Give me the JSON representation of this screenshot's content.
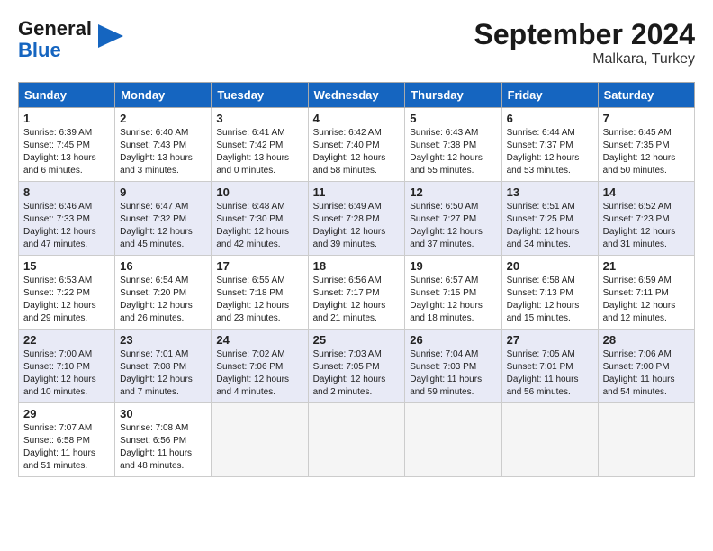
{
  "header": {
    "logo_general": "General",
    "logo_blue": "Blue",
    "month_title": "September 2024",
    "location": "Malkara, Turkey"
  },
  "weekdays": [
    "Sunday",
    "Monday",
    "Tuesday",
    "Wednesday",
    "Thursday",
    "Friday",
    "Saturday"
  ],
  "weeks": [
    [
      {
        "day": "1",
        "sunrise": "Sunrise: 6:39 AM",
        "sunset": "Sunset: 7:45 PM",
        "daylight": "Daylight: 13 hours and 6 minutes."
      },
      {
        "day": "2",
        "sunrise": "Sunrise: 6:40 AM",
        "sunset": "Sunset: 7:43 PM",
        "daylight": "Daylight: 13 hours and 3 minutes."
      },
      {
        "day": "3",
        "sunrise": "Sunrise: 6:41 AM",
        "sunset": "Sunset: 7:42 PM",
        "daylight": "Daylight: 13 hours and 0 minutes."
      },
      {
        "day": "4",
        "sunrise": "Sunrise: 6:42 AM",
        "sunset": "Sunset: 7:40 PM",
        "daylight": "Daylight: 12 hours and 58 minutes."
      },
      {
        "day": "5",
        "sunrise": "Sunrise: 6:43 AM",
        "sunset": "Sunset: 7:38 PM",
        "daylight": "Daylight: 12 hours and 55 minutes."
      },
      {
        "day": "6",
        "sunrise": "Sunrise: 6:44 AM",
        "sunset": "Sunset: 7:37 PM",
        "daylight": "Daylight: 12 hours and 53 minutes."
      },
      {
        "day": "7",
        "sunrise": "Sunrise: 6:45 AM",
        "sunset": "Sunset: 7:35 PM",
        "daylight": "Daylight: 12 hours and 50 minutes."
      }
    ],
    [
      {
        "day": "8",
        "sunrise": "Sunrise: 6:46 AM",
        "sunset": "Sunset: 7:33 PM",
        "daylight": "Daylight: 12 hours and 47 minutes."
      },
      {
        "day": "9",
        "sunrise": "Sunrise: 6:47 AM",
        "sunset": "Sunset: 7:32 PM",
        "daylight": "Daylight: 12 hours and 45 minutes."
      },
      {
        "day": "10",
        "sunrise": "Sunrise: 6:48 AM",
        "sunset": "Sunset: 7:30 PM",
        "daylight": "Daylight: 12 hours and 42 minutes."
      },
      {
        "day": "11",
        "sunrise": "Sunrise: 6:49 AM",
        "sunset": "Sunset: 7:28 PM",
        "daylight": "Daylight: 12 hours and 39 minutes."
      },
      {
        "day": "12",
        "sunrise": "Sunrise: 6:50 AM",
        "sunset": "Sunset: 7:27 PM",
        "daylight": "Daylight: 12 hours and 37 minutes."
      },
      {
        "day": "13",
        "sunrise": "Sunrise: 6:51 AM",
        "sunset": "Sunset: 7:25 PM",
        "daylight": "Daylight: 12 hours and 34 minutes."
      },
      {
        "day": "14",
        "sunrise": "Sunrise: 6:52 AM",
        "sunset": "Sunset: 7:23 PM",
        "daylight": "Daylight: 12 hours and 31 minutes."
      }
    ],
    [
      {
        "day": "15",
        "sunrise": "Sunrise: 6:53 AM",
        "sunset": "Sunset: 7:22 PM",
        "daylight": "Daylight: 12 hours and 29 minutes."
      },
      {
        "day": "16",
        "sunrise": "Sunrise: 6:54 AM",
        "sunset": "Sunset: 7:20 PM",
        "daylight": "Daylight: 12 hours and 26 minutes."
      },
      {
        "day": "17",
        "sunrise": "Sunrise: 6:55 AM",
        "sunset": "Sunset: 7:18 PM",
        "daylight": "Daylight: 12 hours and 23 minutes."
      },
      {
        "day": "18",
        "sunrise": "Sunrise: 6:56 AM",
        "sunset": "Sunset: 7:17 PM",
        "daylight": "Daylight: 12 hours and 21 minutes."
      },
      {
        "day": "19",
        "sunrise": "Sunrise: 6:57 AM",
        "sunset": "Sunset: 7:15 PM",
        "daylight": "Daylight: 12 hours and 18 minutes."
      },
      {
        "day": "20",
        "sunrise": "Sunrise: 6:58 AM",
        "sunset": "Sunset: 7:13 PM",
        "daylight": "Daylight: 12 hours and 15 minutes."
      },
      {
        "day": "21",
        "sunrise": "Sunrise: 6:59 AM",
        "sunset": "Sunset: 7:11 PM",
        "daylight": "Daylight: 12 hours and 12 minutes."
      }
    ],
    [
      {
        "day": "22",
        "sunrise": "Sunrise: 7:00 AM",
        "sunset": "Sunset: 7:10 PM",
        "daylight": "Daylight: 12 hours and 10 minutes."
      },
      {
        "day": "23",
        "sunrise": "Sunrise: 7:01 AM",
        "sunset": "Sunset: 7:08 PM",
        "daylight": "Daylight: 12 hours and 7 minutes."
      },
      {
        "day": "24",
        "sunrise": "Sunrise: 7:02 AM",
        "sunset": "Sunset: 7:06 PM",
        "daylight": "Daylight: 12 hours and 4 minutes."
      },
      {
        "day": "25",
        "sunrise": "Sunrise: 7:03 AM",
        "sunset": "Sunset: 7:05 PM",
        "daylight": "Daylight: 12 hours and 2 minutes."
      },
      {
        "day": "26",
        "sunrise": "Sunrise: 7:04 AM",
        "sunset": "Sunset: 7:03 PM",
        "daylight": "Daylight: 11 hours and 59 minutes."
      },
      {
        "day": "27",
        "sunrise": "Sunrise: 7:05 AM",
        "sunset": "Sunset: 7:01 PM",
        "daylight": "Daylight: 11 hours and 56 minutes."
      },
      {
        "day": "28",
        "sunrise": "Sunrise: 7:06 AM",
        "sunset": "Sunset: 7:00 PM",
        "daylight": "Daylight: 11 hours and 54 minutes."
      }
    ],
    [
      {
        "day": "29",
        "sunrise": "Sunrise: 7:07 AM",
        "sunset": "Sunset: 6:58 PM",
        "daylight": "Daylight: 11 hours and 51 minutes."
      },
      {
        "day": "30",
        "sunrise": "Sunrise: 7:08 AM",
        "sunset": "Sunset: 6:56 PM",
        "daylight": "Daylight: 11 hours and 48 minutes."
      },
      null,
      null,
      null,
      null,
      null
    ]
  ]
}
